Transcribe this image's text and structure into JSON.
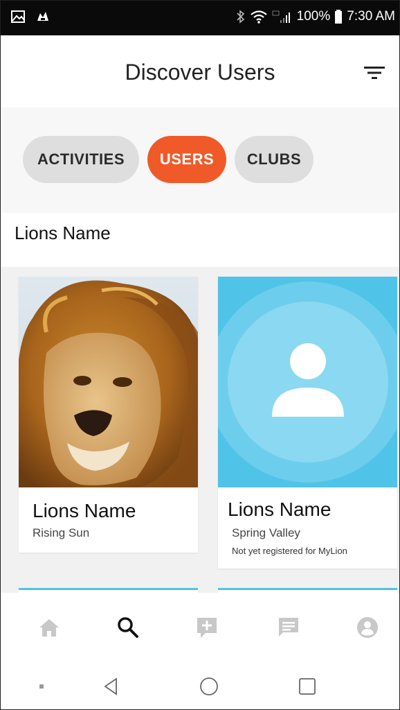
{
  "status_bar": {
    "battery": "100%",
    "time": "7:30 AM",
    "icons": [
      "gallery-icon",
      "notification-icon",
      "bluetooth-icon",
      "wifi-icon",
      "signal-icon",
      "battery-icon"
    ]
  },
  "header": {
    "title": "Discover Users",
    "filter_icon": "filter-icon"
  },
  "segments": [
    {
      "label": "ACTIVITIES",
      "active": false
    },
    {
      "label": "USERS",
      "active": true
    },
    {
      "label": "CLUBS",
      "active": false
    }
  ],
  "search": {
    "value": "Lions Name"
  },
  "users": [
    {
      "name": "Lions Name",
      "club": "Rising Sun",
      "note": "",
      "photo": "lion-photo"
    },
    {
      "name": "Lions Name",
      "club": "Spring Valley",
      "note": "Not yet registered for MyLion",
      "photo": "default-avatar"
    }
  ],
  "bottom_nav": [
    {
      "icon": "home-icon",
      "active": false
    },
    {
      "icon": "search-icon",
      "active": true
    },
    {
      "icon": "add-post-icon",
      "active": false
    },
    {
      "icon": "messages-icon",
      "active": false
    },
    {
      "icon": "profile-icon",
      "active": false
    }
  ],
  "colors": {
    "accent": "#f05a28",
    "avatar_bg": "#4fc3e8",
    "inactive_icon": "#c8c8c8",
    "pill_inactive": "#dedede"
  }
}
